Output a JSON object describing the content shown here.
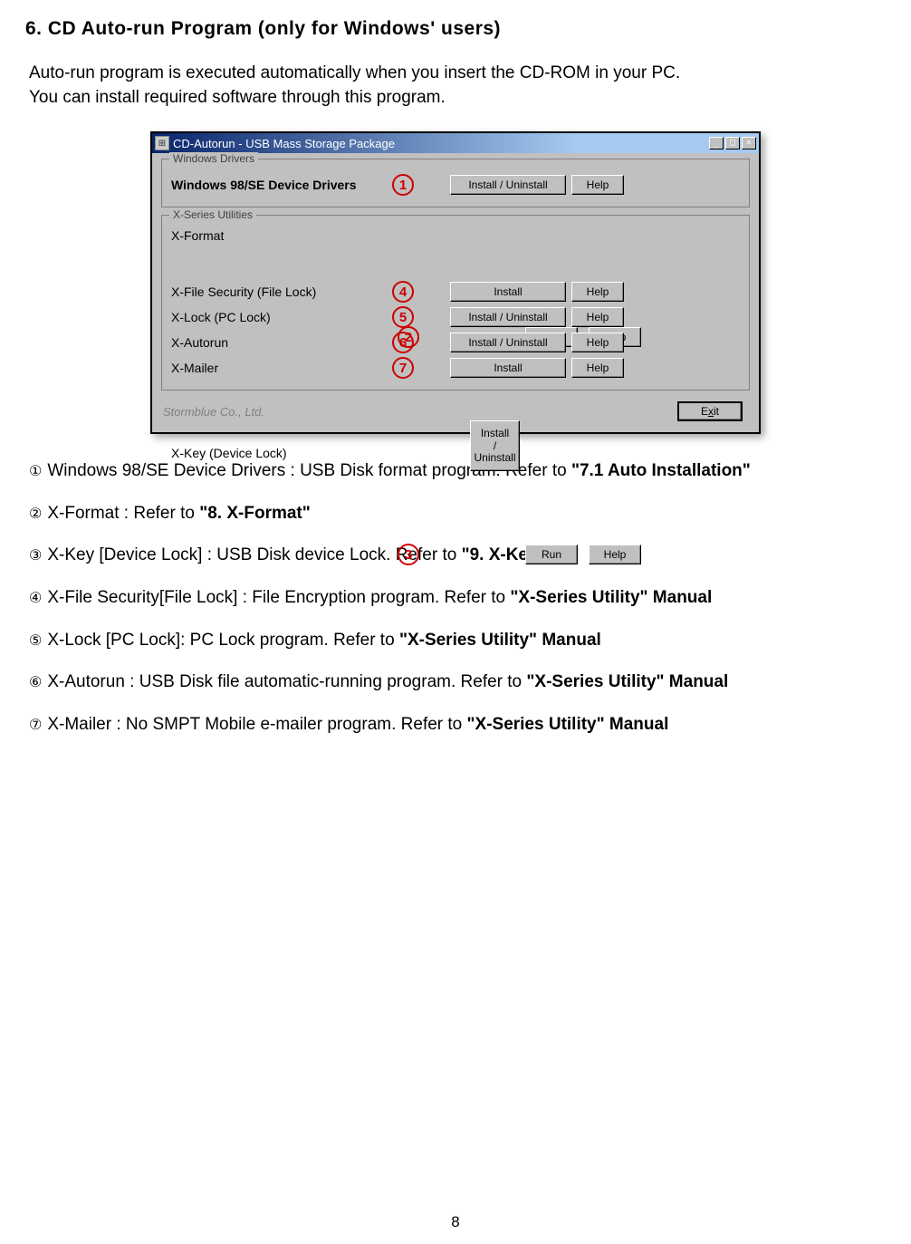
{
  "section_title": "6.  CD Auto-run Program (only for Windows'   users)",
  "intro_line1": "Auto-run program is executed automatically when you insert the CD-ROM in your PC.",
  "intro_line2": "You can install required software through this program.",
  "window": {
    "title": "CD-Autorun - USB Mass Storage Package",
    "min": "_",
    "max": "□",
    "close": "×",
    "group_drivers_title": "Windows Drivers",
    "group_utils_title": "X-Series Utilities",
    "drv1_label": "Windows 98/SE Device Drivers",
    "util_labels": {
      "2": "X-Format",
      "3": "X-Key (Device Lock)",
      "4": "X-File Security (File Lock)",
      "5": "X-Lock (PC Lock)",
      "6": "X-Autorun",
      "7": "X-Mailer"
    },
    "nums": {
      "1": "1",
      "2": "2",
      "3": "3",
      "4": "4",
      "5": "5",
      "6": "6",
      "7": "7"
    },
    "btn_install_uninstall": "Install / Uninstall",
    "btn_install_stack": "Install\n/\nUninstall",
    "btn_run": "Run",
    "btn_install": "Install",
    "btn_help": "Help",
    "btn_exit": "Exit",
    "footer": "Stormblue Co., Ltd."
  },
  "items": [
    {
      "num": "①",
      "pre": "Windows 98/SE Device Drivers : USB Disk format program. Refer to ",
      "bold": "\"7.1 Auto Installation\"",
      "post": ""
    },
    {
      "num": "②",
      "pre": " X-Format : Refer to ",
      "bold": "\"8.  X-Format\"",
      "post": ""
    },
    {
      "num": "③",
      "pre": " X-Key [Device Lock] : USB Disk device Lock. Refer to ",
      "bold": "\"9.  X-Key\"",
      "post": ""
    },
    {
      "num": "④",
      "pre": " X-File Security[File Lock] : File Encryption program. Refer to ",
      "bold": "\"X-Series Utility\"  Manual",
      "post": ""
    },
    {
      "num": "⑤",
      "pre": " X-Lock [PC Lock]: PC Lock program. Refer to ",
      "bold": "\"X-Series Utility\"  Manual",
      "post": ""
    },
    {
      "num": "⑥",
      "pre": " X-Autorun : USB Disk file automatic-running program. Refer to ",
      "bold": "\"X-Series Utility\"  Manual",
      "post": ""
    },
    {
      "num": "⑦",
      "pre": " X-Mailer : No SMPT Mobile e-mailer program. Refer to ",
      "bold": "\"X-Series Utility\"  Manual",
      "post": ""
    }
  ],
  "page_number": "8"
}
